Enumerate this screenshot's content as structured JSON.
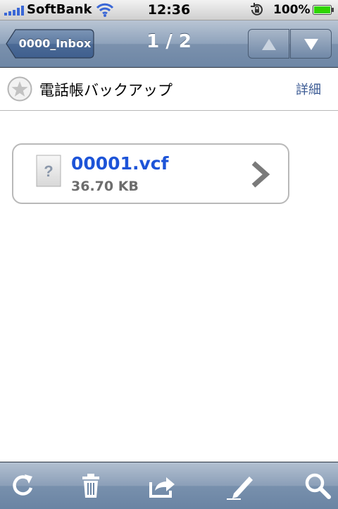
{
  "status_bar": {
    "carrier": "SoftBank",
    "time": "12:36",
    "battery_percent": "100%",
    "signal_bars": 5,
    "battery_level": 1.0,
    "icons": [
      "signal-bars-icon",
      "wifi-icon",
      "rotation-lock-icon",
      "battery-icon"
    ]
  },
  "nav": {
    "back_label": "0000_Inbox",
    "position": "1 / 2",
    "icons": [
      "arrow-up-icon",
      "arrow-down-icon"
    ]
  },
  "message": {
    "subject": "電話帳バックアップ",
    "detail_label": "詳細",
    "starred": false
  },
  "attachment": {
    "filename": "00001.vcf",
    "size": "36.70 KB",
    "icons": [
      "unknown-file-icon",
      "chevron-right-icon"
    ]
  },
  "toolbar": {
    "icons": [
      "refresh-icon",
      "trash-icon",
      "forward-icon",
      "compose-icon",
      "search-icon"
    ]
  },
  "colors": {
    "accent_link": "#3c5b94",
    "attachment_name": "#1d54d8",
    "battery_green": "#2fd400"
  }
}
